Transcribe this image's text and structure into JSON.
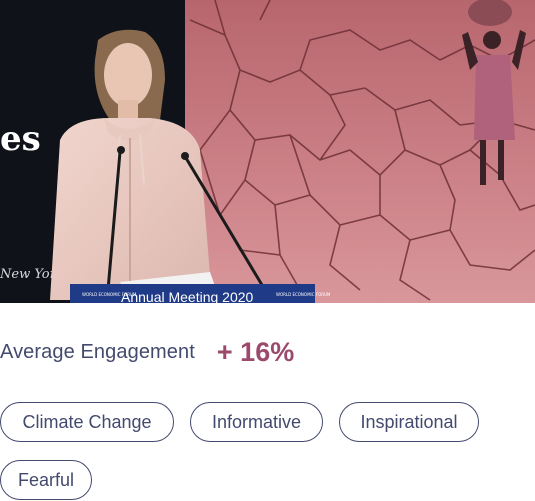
{
  "hero": {
    "backdrop_text": "es",
    "masthead_text": "New York",
    "podium_text": "Annual Meeting 2020",
    "podium_logo_left": "WORLD ECONOMIC FORUM",
    "podium_logo_right": "WORLD ECONOMIC FORUM",
    "tint_color": "#c7828a"
  },
  "engagement": {
    "label": "Average Engagement",
    "value": "+ 16%"
  },
  "tags": [
    {
      "label": "Climate Change"
    },
    {
      "label": "Informative"
    },
    {
      "label": "Inspirational"
    },
    {
      "label": "Fearful"
    }
  ],
  "colors": {
    "text": "#434a6e",
    "accent": "#9b4a6c",
    "tag_border": "#434a6e"
  }
}
